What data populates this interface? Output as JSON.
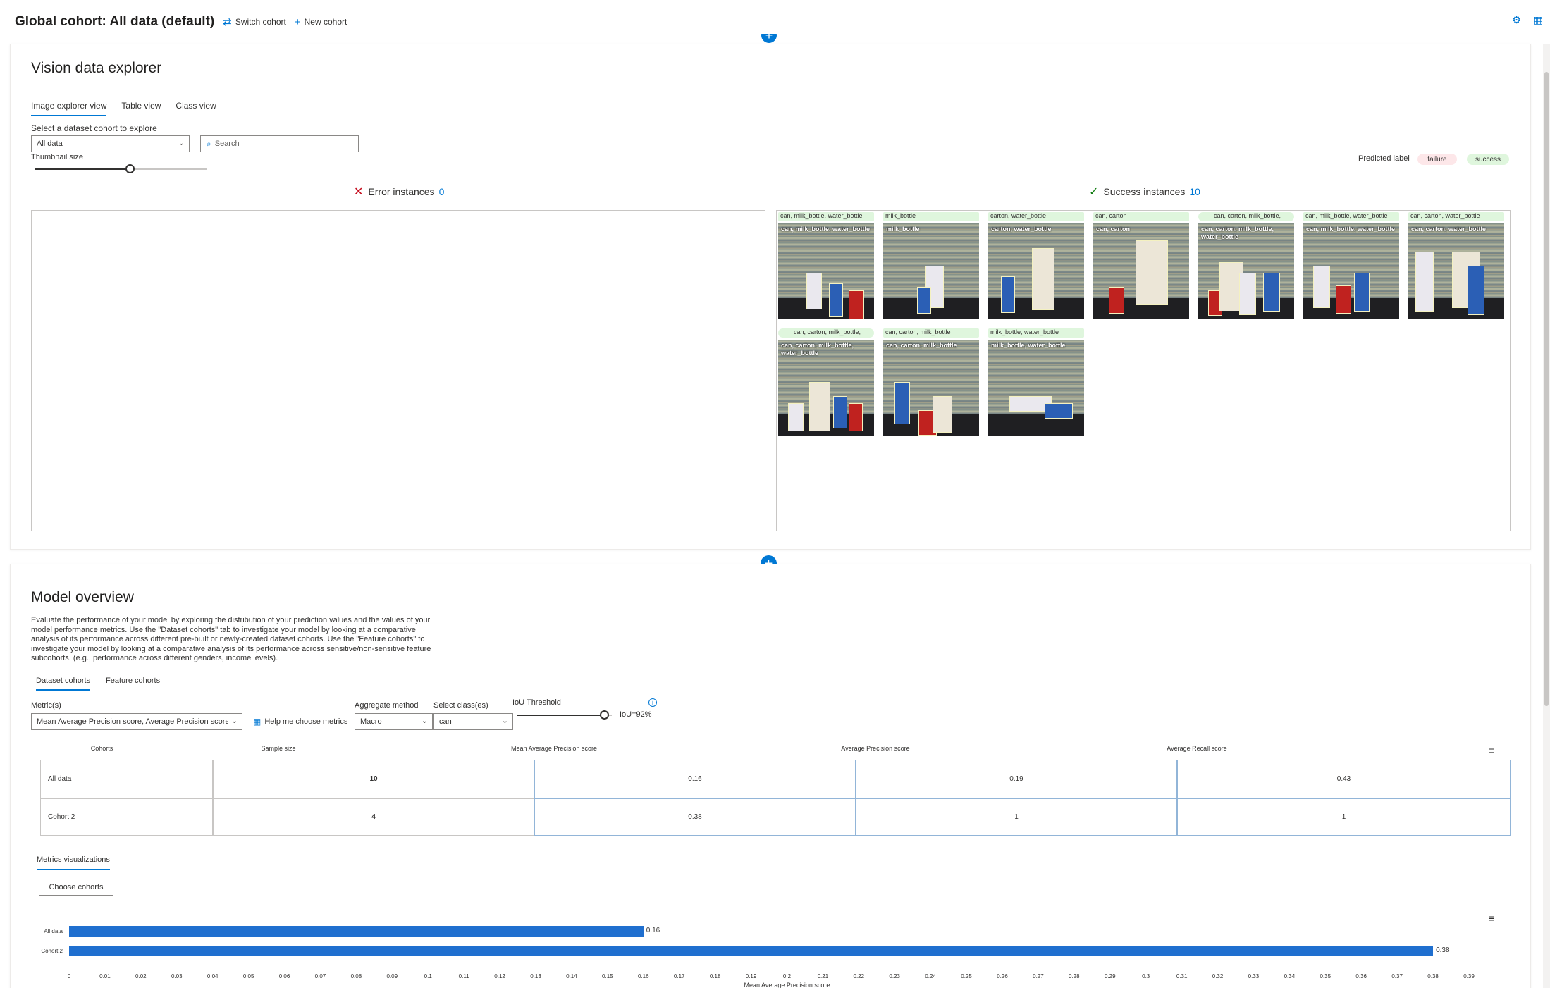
{
  "header": {
    "title": "Global cohort: All data (default)",
    "switch_cohort": "Switch cohort",
    "new_cohort": "New cohort"
  },
  "vision_explorer": {
    "title": "Vision data explorer",
    "tabs": [
      "Image explorer view",
      "Table view",
      "Class view"
    ],
    "select_label": "Select a dataset cohort to explore",
    "cohort_value": "All data",
    "search_placeholder": "Search",
    "thumbnail_label": "Thumbnail size",
    "thumbnail_value": 0.55,
    "predicted_label": "Predicted label",
    "legend_failure": "failure",
    "legend_success": "success",
    "error_label": "Error instances",
    "error_count": "0",
    "success_label": "Success instances",
    "success_count": "10",
    "thumbnails": [
      {
        "caption": "can, milk_bottle, water_bottle",
        "overlay": "can, milk_bottle, water_bottle"
      },
      {
        "caption": "milk_bottle",
        "overlay": "milk_bottle"
      },
      {
        "caption": "carton, water_bottle",
        "overlay": "carton, water_bottle"
      },
      {
        "caption": "can, carton",
        "overlay": "can, carton"
      },
      {
        "caption": "can, carton, milk_bottle,",
        "overlay": "can, carton, milk_bottle, water_bottle"
      },
      {
        "caption": "can, milk_bottle, water_bottle",
        "overlay": "can, milk_bottle, water_bottle"
      },
      {
        "caption": "can, carton, water_bottle",
        "overlay": "can, carton, water_bottle"
      },
      {
        "caption": "can, carton, milk_bottle,",
        "overlay": "can, carton, milk_bottle, water_bottle"
      },
      {
        "caption": "can, carton, milk_bottle",
        "overlay": "can, carton, milk_bottle"
      },
      {
        "caption": "milk_bottle, water_bottle",
        "overlay": "milk_bottle, water_bottle"
      }
    ]
  },
  "model_overview": {
    "title": "Model overview",
    "description": "Evaluate the performance of your model by exploring the distribution of your prediction values and the values of your model performance metrics. Use the \"Dataset cohorts\" tab to investigate your model by looking at a comparative analysis of its performance across different pre-built or newly-created dataset cohorts. Use the \"Feature cohorts\" to investigate your model by looking at a comparative analysis of its performance across sensitive/non-sensitive feature subcohorts. (e.g., performance across different genders, income levels).",
    "tabs": [
      "Dataset cohorts",
      "Feature cohorts"
    ],
    "metrics_label": "Metric(s)",
    "metrics_value": "Mean Average Precision score, Average Precision score, ...",
    "help_label": "Help me choose metrics",
    "aggregate_label": "Aggregate method",
    "aggregate_value": "Macro",
    "class_label": "Select class(es)",
    "class_value": "can",
    "iou_label": "IoU Threshold",
    "iou_value": "IoU=92%",
    "iou_fraction": 0.92,
    "table": {
      "headers": [
        "Cohorts",
        "Sample size",
        "Mean Average Precision score",
        "Average Precision score",
        "Average Recall score"
      ],
      "rows": [
        [
          "All data",
          "10",
          "0.16",
          "0.19",
          "0.43"
        ],
        [
          "Cohort 2",
          "4",
          "0.38",
          "1",
          "1"
        ]
      ]
    },
    "viz_tab": "Metrics visualizations",
    "choose_cohorts": "Choose cohorts"
  },
  "chart_data": {
    "type": "bar",
    "orientation": "horizontal",
    "categories": [
      "All data",
      "Cohort 2"
    ],
    "values": [
      0.16,
      0.38
    ],
    "xlabel": "Mean Average Precision score",
    "xlim": [
      0,
      0.39
    ],
    "xticks": [
      "0",
      "0.01",
      "0.02",
      "0.03",
      "0.04",
      "0.05",
      "0.06",
      "0.07",
      "0.08",
      "0.09",
      "0.1",
      "0.11",
      "0.12",
      "0.13",
      "0.14",
      "0.15",
      "0.16",
      "0.17",
      "0.18",
      "0.19",
      "0.2",
      "0.21",
      "0.22",
      "0.23",
      "0.24",
      "0.25",
      "0.26",
      "0.27",
      "0.28",
      "0.29",
      "0.3",
      "0.31",
      "0.32",
      "0.33",
      "0.34",
      "0.35",
      "0.36",
      "0.37",
      "0.38",
      "0.39"
    ],
    "bar_color": "#1f6fcf"
  },
  "colors": {
    "accent": "#0078d4",
    "failure_pill": "#fde7e9",
    "success_pill": "#dff6dd",
    "error_icon": "#c50f1f"
  }
}
